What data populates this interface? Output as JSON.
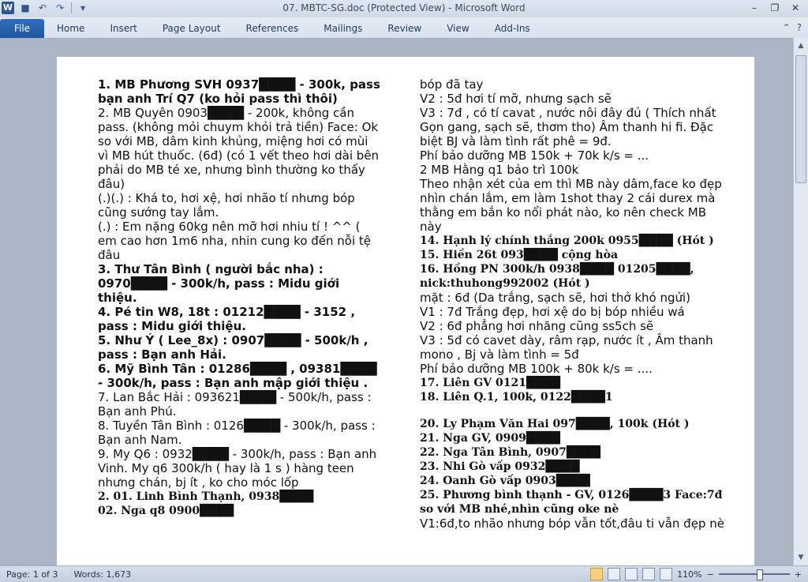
{
  "window": {
    "title": "07. MBTC-SG.doc (Protected View) - Microsoft Word",
    "app_icon": "W"
  },
  "ribbon": {
    "file_tab": "File",
    "tabs": [
      "Home",
      "Insert",
      "Page Layout",
      "References",
      "Mailings",
      "Review",
      "View",
      "Add-Ins"
    ]
  },
  "document": {
    "left_column": [
      "1.  MB Phương SVH 0937████ - 300k, pass bạn anh Trí Q7 (ko hỏi pass thì thôi)",
      "2. MB Quyên  0903████ - 200k, không cần pass. (không mỏi chuym khỏi trả tiền) Face: Ok so với MB, dâm kinh khủng, miệng hơi có mùi vì MB hút thuốc. (6đ) (có 1 vết theo hơi dài bên phải do MB té xe, nhưng bình  thường ko thấy đâu)",
      "(.)(.) : Khá to, hơi xệ, hơi nhão tí nhưng bóp cũng sướng tay lắm.",
      "(.) : Em nặng 60kg nên mỡ hơi nhiu  tí ! ^^ ( em cao hơn 1m6 nha, nhin cung ko đến nỗi tệ đâu",
      "3. Thư Tân Bình ( người bắc nha) : 0970████ - 300k/h, pass : Midu giới thiệu.",
      "4. Pé tin W8, 18t : 01212████ - 3152 , pass : Midu giới thiệu.",
      "5. Như Ý ( Lee_8x) : 0907████ - 500k/h , pass : Bạn anh Hải.",
      "6. Mỹ Bình  Tân  : 01286████ , 09381████ - 300k/h, pass : Bạn anh mập giới thiệu  .",
      "7. Lan Bắc Hải : 093621████ - 500k/h, pass : Bạn anh Phú.",
      "8. Tuyền Tân Bình : 0126████ - 300k/h, pass : Bạn anh Nam.",
      "9. My Q6 : 0932████ - 300k/h, pass : Bạn anh Vinh. My q6 300k/h ( hay là 1 s ) hàng teen nhưng chán, bj ít , ko cho móc lốp",
      "2.  01. Linh  Bình Thạnh, 0938████",
      "02. Nga q8 0900████"
    ],
    "right_column": [
      "bóp đã tay",
      "V2 : 5đ hơi tí mỡ, nhưng sạch sẽ",
      "V3 : 7đ , có tí cavat , nước nôi đây đủ ( Thích nhất Gọn gang, sạch sẽ, thơm tho) Âm thanh hi fi. Đặc biệt BJ và làm tình rất phê = 9đ.",
      "Phí bảo dưỡng MB 150k + 70k k/s = ...",
      "2    MB Hằng q1 bảo trì 100k",
      "Theo nhận xét của em thì MB này dâm,face ko đẹp nhìn chán lắm, em làm 1shot thay 2 cái durex mà thằng em bắn ko nổi phát nào, ko nên check MB này",
      "14. Hạnh lý chính thắng 200k 0955████ (Hót )",
      "15. Hiền 26t 093████ cộng hòa",
      "16. Hồng PN 300k/h 0938████ 01205████,",
      "nick:thuhong992002  (Hót )",
      "mặt : 6đ (Da trắng, sạch sẽ, hơi thở khó ngửi)",
      "V1 : 7đ Trắng đẹp, hơi xệ do bị bóp nhiều  wá",
      "V2 : 6đ phẳng hơi nhăng cũng ss5ch sẽ",
      "V3 : 5đ có cavet dày, râm rạp, nước ít , Âm thanh mono , Bj và làm tình  = 5đ",
      "Phí bảo dưỡng MB 100k + 80k k/s = ....",
      "17. Liên GV 0121████",
      "18. Liên Q.1, 100k, 0122████1",
      "20. Ly Phạm Văn Hai  097████, 100k (Hót )",
      "21. Nga GV, 0909████",
      "22. Nga Tân Bình, 0907████",
      "23. Nhi Gò vấp 0932████",
      "24. Oanh Gò vấp 0903████",
      "25. Phương bình thạnh - GV, 0126████3 Face:7đ so với MB nhé,nhìn  cũng oke nè",
      "V1:6đ,to nhão nhưng bóp vẫn tốt,đâu ti vẫn đẹp nè"
    ]
  },
  "status": {
    "page": "Page: 1 of 3",
    "words": "Words: 1,673",
    "zoom": "110%"
  }
}
